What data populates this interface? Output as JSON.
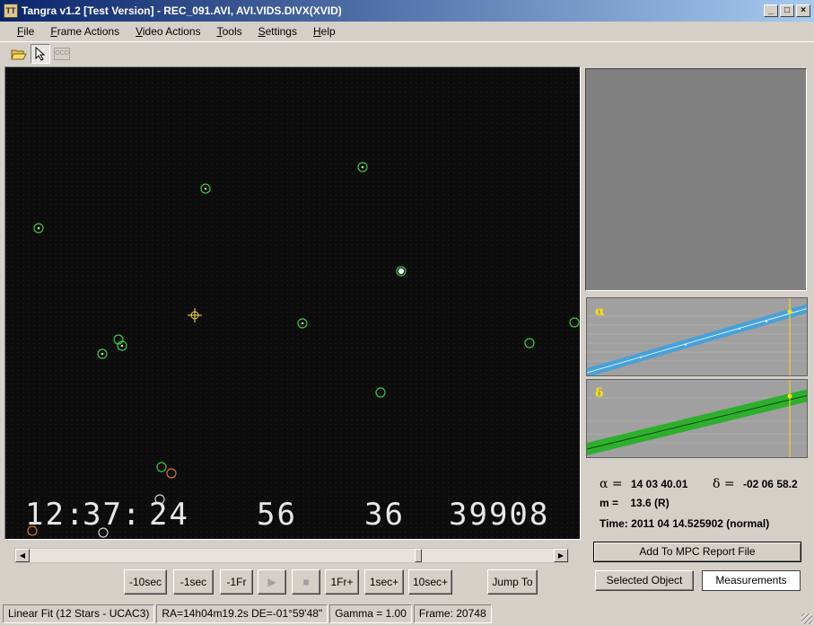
{
  "window": {
    "title": "Tangra v1.2 [Test Version] - REC_091.AVI, AVI.VIDS.DIVX(XVID)",
    "minimize": "_",
    "maximize": "□",
    "close": "×"
  },
  "menu": {
    "items": [
      {
        "label": "File",
        "accel": "F",
        "rest": "ile"
      },
      {
        "label": "Frame Actions",
        "accel": "F",
        "rest": "rame Actions"
      },
      {
        "label": "Video Actions",
        "accel": "V",
        "rest": "ideo Actions"
      },
      {
        "label": "Tools",
        "accel": "T",
        "rest": "ools"
      },
      {
        "label": "Settings",
        "accel": "S",
        "rest": "ettings"
      },
      {
        "label": "Help",
        "accel": "H",
        "rest": "elp"
      }
    ]
  },
  "toolbar": {
    "icons": [
      "open-folder-icon",
      "pointer-arrow-icon",
      "ocd-icon"
    ],
    "ocd_label": "OCD"
  },
  "video": {
    "osd": {
      "hours": "12",
      "minutes": "37",
      "seconds": "24",
      "fields": [
        "56",
        "36",
        "39908"
      ]
    }
  },
  "playback": {
    "scroll_left": "◀",
    "scroll_right": "▶",
    "position_fraction": 0.745,
    "buttons": {
      "back10sec": "-10sec",
      "back1sec": "-1sec",
      "back1fr": "-1Fr",
      "play": "▶",
      "stop": "■",
      "fwd1fr": "1Fr+",
      "fwd1sec": "1sec+",
      "fwd10sec": "10sec+",
      "jump": "Jump To"
    }
  },
  "graphs": {
    "ra_label": "α",
    "dec_label": "δ"
  },
  "measurement": {
    "alpha_sym": "α =",
    "alpha_value": "14 03 40.01",
    "delta_sym": "δ =",
    "delta_value": "-02 06 58.2",
    "mag_label": "m =",
    "mag_value": "13.6 (R)",
    "time_label": "Time:",
    "time_value": "2011 04 14.525902 (normal)"
  },
  "actions": {
    "add_mpc": "Add To MPC Report File",
    "tab_selected_object": "Selected Object",
    "tab_measurements": "Measurements"
  },
  "status": {
    "fit": "Linear Fit (12 Stars - UCAC3)",
    "coords": "RA=14h04m19.2s DE=-01°59'48\"",
    "gamma": "Gamma = 1.00",
    "frame": "Frame: 20748"
  },
  "colors": {
    "star_marker": "#3ec83e",
    "target_marker": "#ffe040",
    "orange_marker": "#e07030",
    "ra_band": "#3aa0e0",
    "dec_band": "#20b020"
  }
}
